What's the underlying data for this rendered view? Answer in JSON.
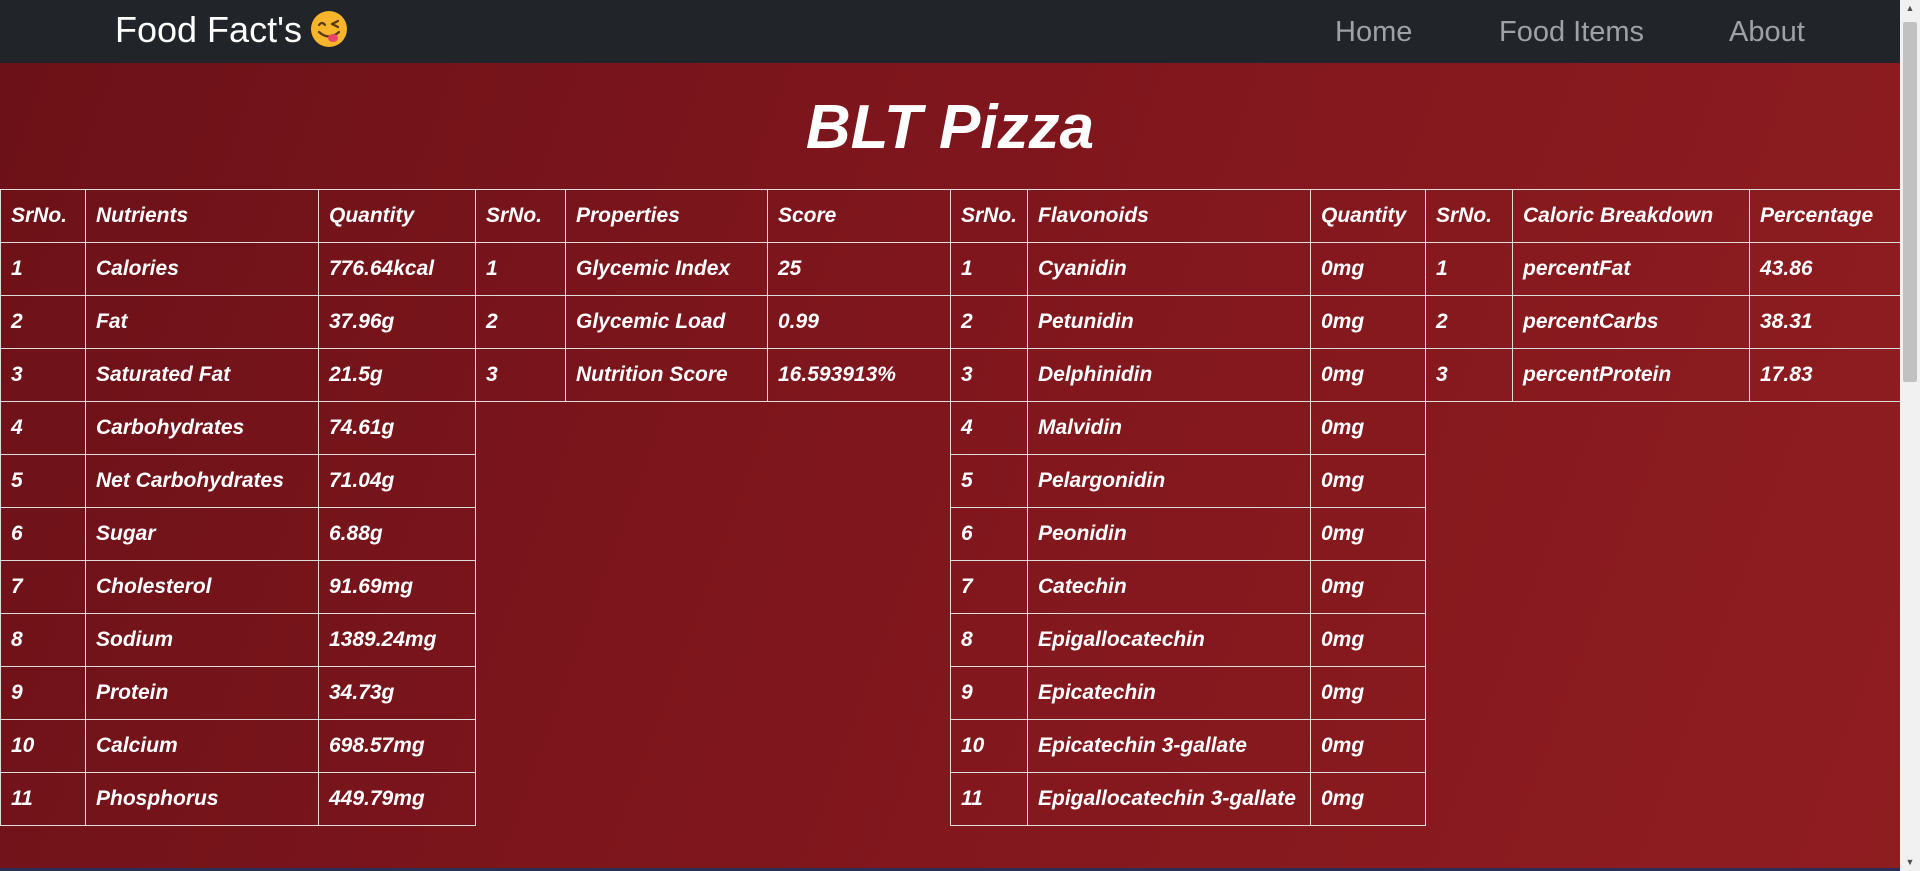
{
  "nav": {
    "brand": "Food Fact's",
    "links": [
      "Home",
      "Food Items",
      "About"
    ]
  },
  "page": {
    "title": "BLT Pizza"
  },
  "tables": {
    "nutrients": {
      "headers": [
        "SrNo.",
        "Nutrients",
        "Quantity"
      ],
      "rows": [
        [
          "1",
          "Calories",
          "776.64kcal"
        ],
        [
          "2",
          "Fat",
          "37.96g"
        ],
        [
          "3",
          "Saturated Fat",
          "21.5g"
        ],
        [
          "4",
          "Carbohydrates",
          "74.61g"
        ],
        [
          "5",
          "Net Carbohydrates",
          "71.04g"
        ],
        [
          "6",
          "Sugar",
          "6.88g"
        ],
        [
          "7",
          "Cholesterol",
          "91.69mg"
        ],
        [
          "8",
          "Sodium",
          "1389.24mg"
        ],
        [
          "9",
          "Protein",
          "34.73g"
        ],
        [
          "10",
          "Calcium",
          "698.57mg"
        ],
        [
          "11",
          "Phosphorus",
          "449.79mg"
        ]
      ]
    },
    "properties": {
      "headers": [
        "SrNo.",
        "Properties",
        "Score"
      ],
      "rows": [
        [
          "1",
          "Glycemic Index",
          "25"
        ],
        [
          "2",
          "Glycemic Load",
          "0.99"
        ],
        [
          "3",
          "Nutrition Score",
          "16.593913%"
        ]
      ]
    },
    "flavonoids": {
      "headers": [
        "SrNo.",
        "Flavonoids",
        "Quantity"
      ],
      "rows": [
        [
          "1",
          "Cyanidin",
          "0mg"
        ],
        [
          "2",
          "Petunidin",
          "0mg"
        ],
        [
          "3",
          "Delphinidin",
          "0mg"
        ],
        [
          "4",
          "Malvidin",
          "0mg"
        ],
        [
          "5",
          "Pelargonidin",
          "0mg"
        ],
        [
          "6",
          "Peonidin",
          "0mg"
        ],
        [
          "7",
          "Catechin",
          "0mg"
        ],
        [
          "8",
          "Epigallocatechin",
          "0mg"
        ],
        [
          "9",
          "Epicatechin",
          "0mg"
        ],
        [
          "10",
          "Epicatechin 3-gallate",
          "0mg"
        ],
        [
          "11",
          "Epigallocatechin 3-gallate",
          "0mg"
        ]
      ]
    },
    "caloric": {
      "headers": [
        "SrNo.",
        "Caloric Breakdown",
        "Percentage"
      ],
      "rows": [
        [
          "1",
          "percentFat",
          "43.86"
        ],
        [
          "2",
          "percentCarbs",
          "38.31"
        ],
        [
          "3",
          "percentProtein",
          "17.83"
        ]
      ]
    }
  },
  "colors": {
    "navbar": "#212529",
    "nav_link": "#9ea2a6",
    "background_start": "#6c1118",
    "background_end": "#8f1d20"
  }
}
